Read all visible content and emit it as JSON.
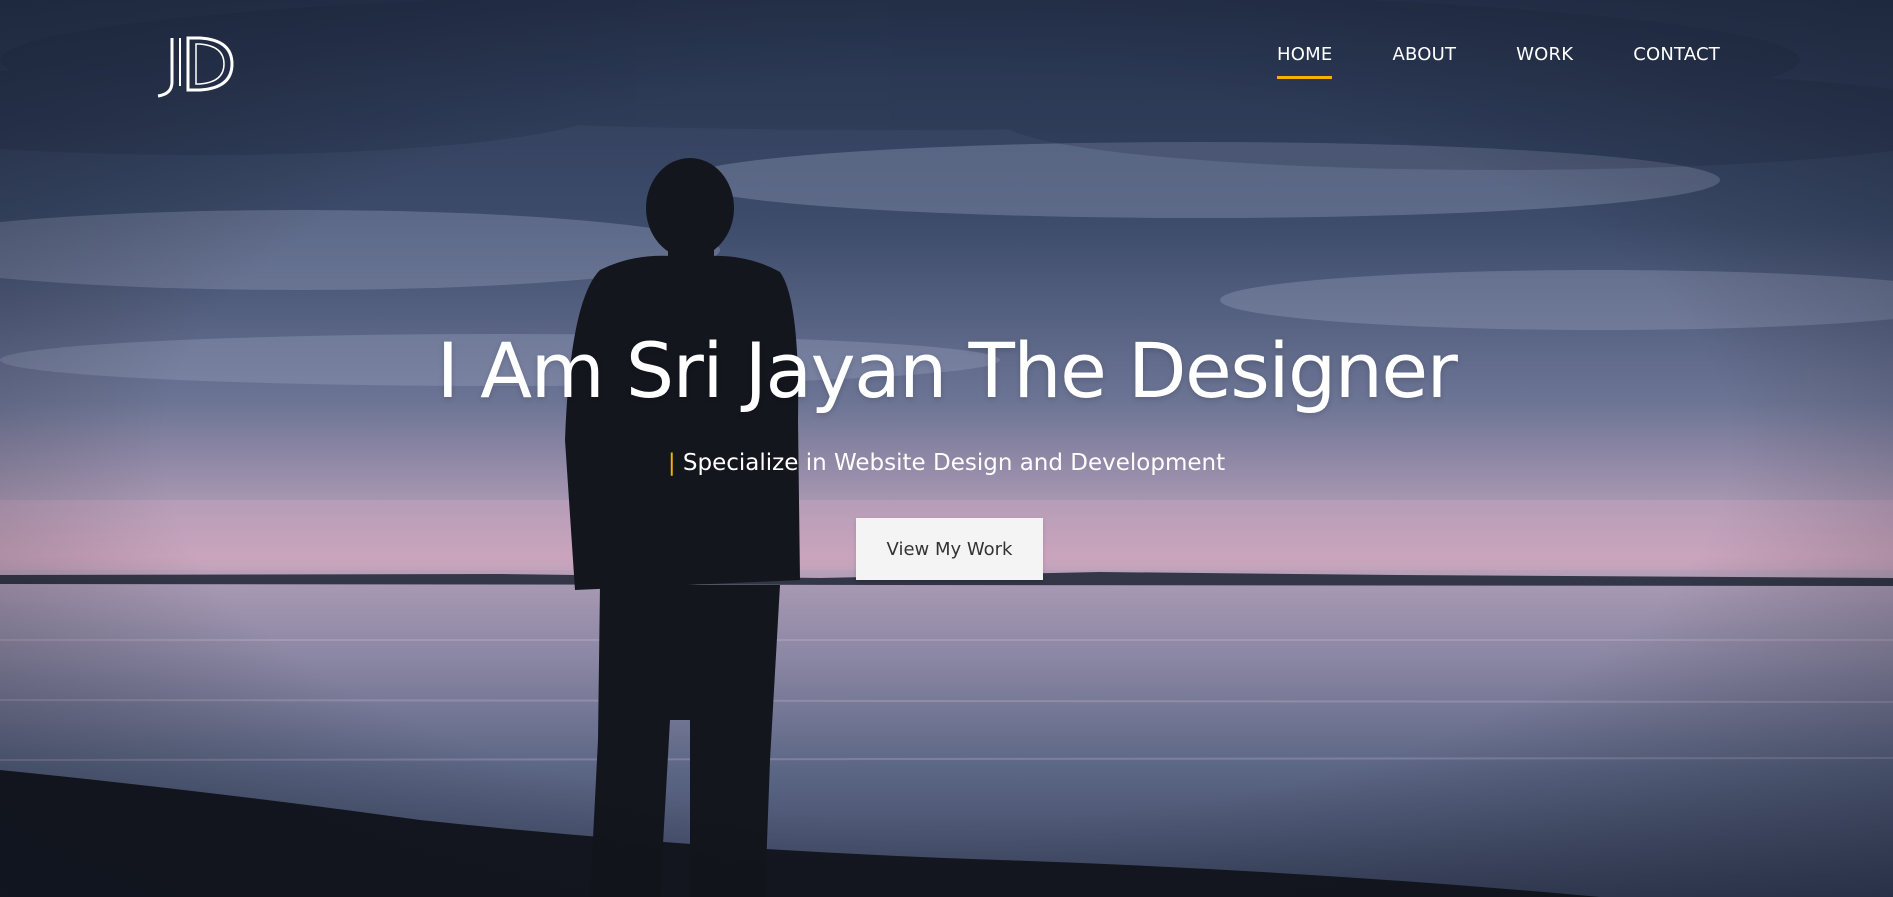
{
  "logo": {
    "text": "JD"
  },
  "nav": {
    "items": [
      {
        "label": "HOME",
        "active": true
      },
      {
        "label": "ABOUT",
        "active": false
      },
      {
        "label": "WORK",
        "active": false
      },
      {
        "label": "CONTACT",
        "active": false
      }
    ]
  },
  "hero": {
    "title": "I Am Sri Jayan The Designer",
    "subtitle_prefix": "|",
    "subtitle": "Specialize in Website Design and Development",
    "cta_label": "View My Work"
  },
  "colors": {
    "accent": "#f2b400",
    "sky_top": "#2b3a58",
    "sky_horizon": "#c9a3bb",
    "water": "#5a6786",
    "cta_bg": "#f4f4f4"
  },
  "icons": {
    "logo": "jd-monogram-icon"
  }
}
